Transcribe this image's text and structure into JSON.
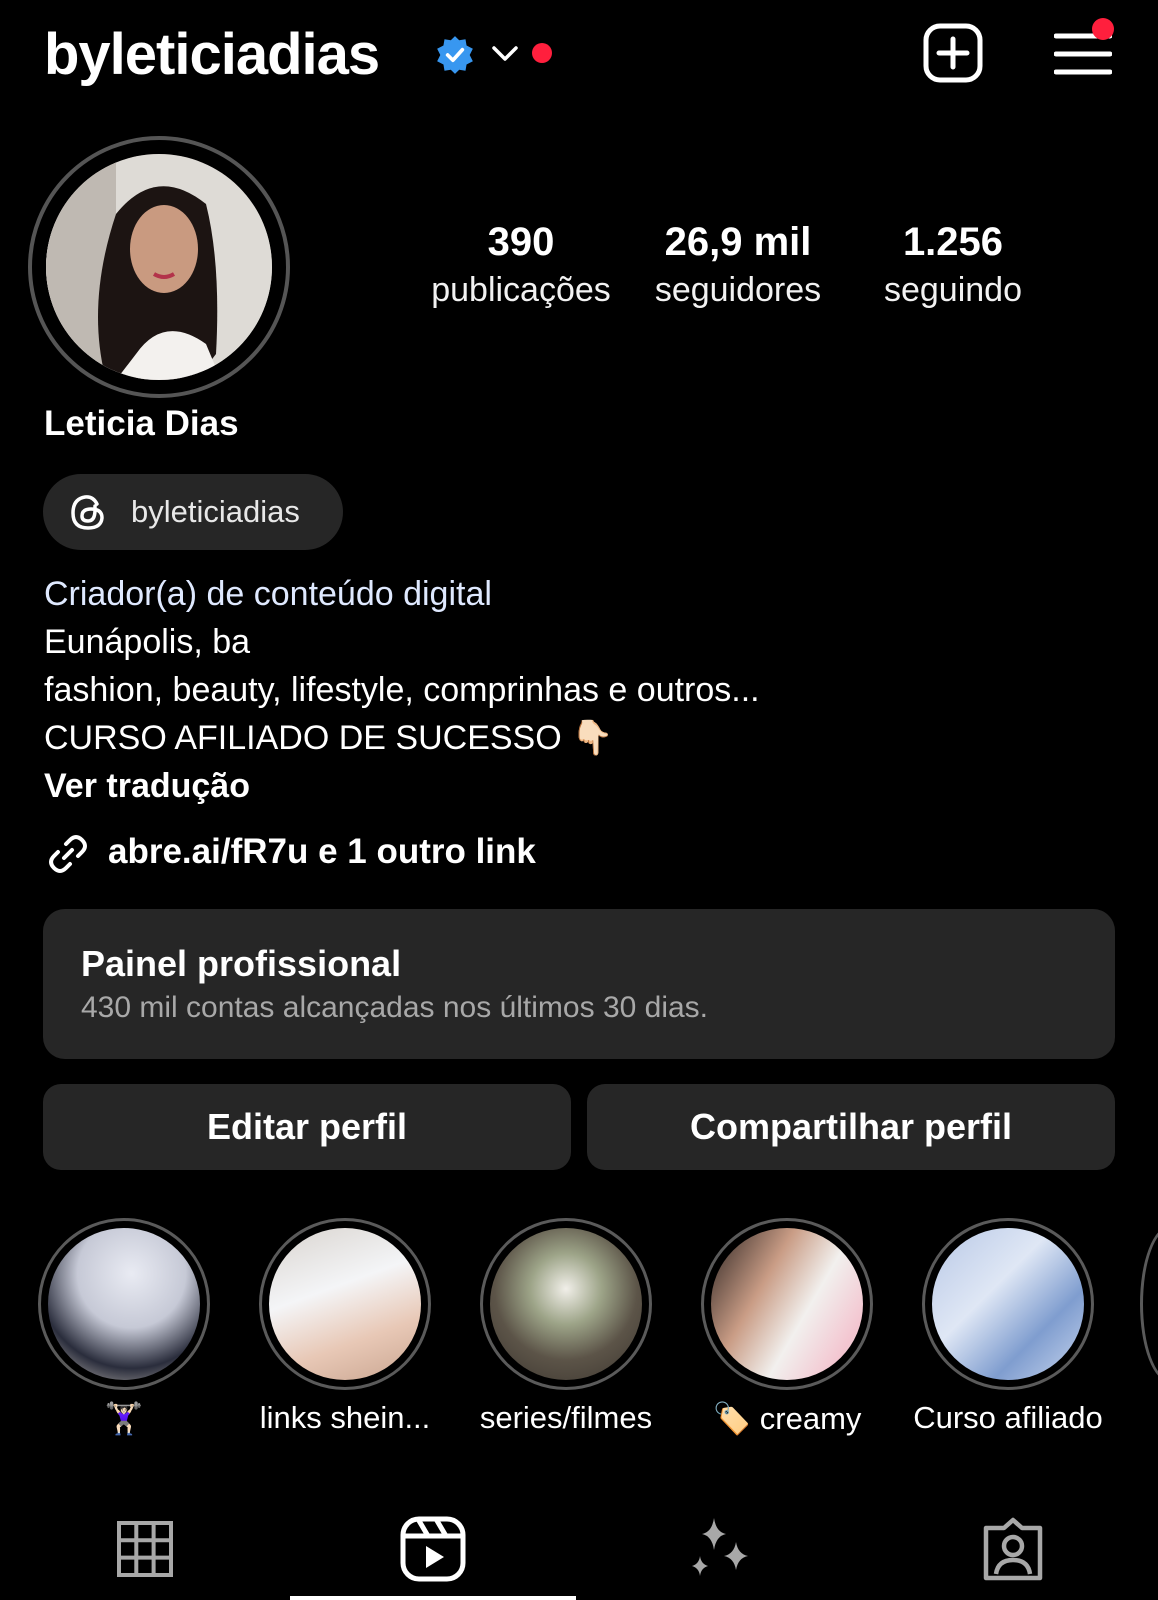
{
  "header": {
    "username": "byleticiadias",
    "verified_icon": "verified-badge-icon",
    "dropdown_icon": "chevron-down-icon",
    "new_post_icon": "plus-square-icon",
    "menu_icon": "hamburger-menu-icon",
    "accent_color": "#3897f0",
    "notification_color": "#ff1f3d"
  },
  "profile": {
    "display_name": "Leticia Dias",
    "threads_handle": "byleticiadias",
    "stats": [
      {
        "value": "390",
        "label": "publicações"
      },
      {
        "value": "26,9 mil",
        "label": "seguidores"
      },
      {
        "value": "1.256",
        "label": "seguindo"
      }
    ],
    "bio": {
      "category": "Criador(a) de conteúdo digital",
      "line1": "Eunápolis, ba",
      "line2": "fashion, beauty, lifestyle, comprinhas e outros...",
      "line3": "CURSO AFILIADO DE SUCESSO 👇🏻",
      "translate": "Ver tradução"
    },
    "link": "abre.ai/fR7u e 1 outro link"
  },
  "panel": {
    "title": "Painel profissional",
    "subtitle": "430 mil contas alcançadas nos últimos 30 dias."
  },
  "buttons": {
    "edit": "Editar perfil",
    "share": "Compartilhar perfil"
  },
  "highlights": [
    {
      "label": "🏋🏻‍♀️"
    },
    {
      "label": "links shein..."
    },
    {
      "label": "series/filmes"
    },
    {
      "label": "🏷️ creamy"
    },
    {
      "label": "Curso afiliado"
    }
  ],
  "tabs": [
    {
      "icon": "grid-icon"
    },
    {
      "icon": "reels-icon",
      "active": true
    },
    {
      "icon": "sparkles-icon"
    },
    {
      "icon": "tagged-person-icon"
    }
  ]
}
